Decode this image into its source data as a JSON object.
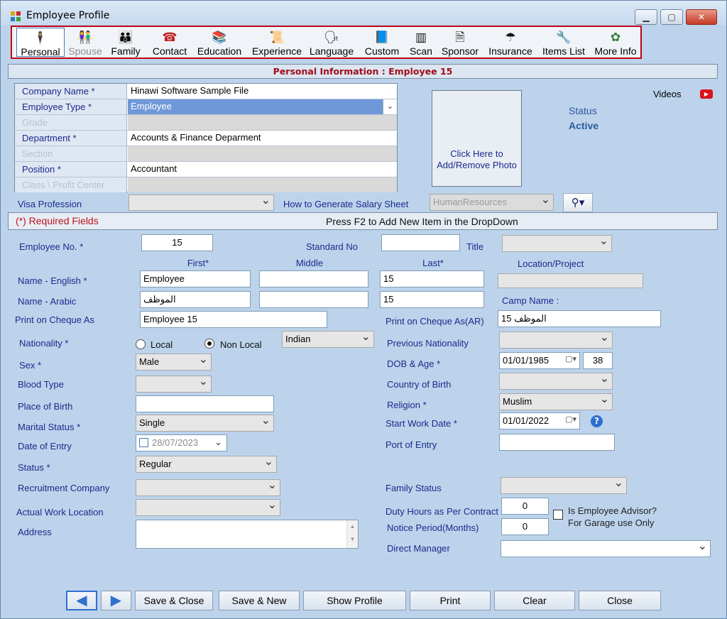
{
  "window": {
    "title": "Employee Profile",
    "minimize": "▁",
    "maximize": "▢",
    "close": "✕"
  },
  "toolbar": [
    {
      "label": "Personal",
      "icon": "person-icon",
      "glyph": "🕴",
      "selected": true
    },
    {
      "label": "Spouse",
      "icon": "couple-icon",
      "glyph": "👫",
      "disabled": true
    },
    {
      "label": "Family",
      "icon": "family-icon",
      "glyph": "👪"
    },
    {
      "label": "Contact",
      "icon": "telephone-icon",
      "glyph": "☎"
    },
    {
      "label": "Education",
      "icon": "books-icon",
      "glyph": "📚"
    },
    {
      "label": "Experience",
      "icon": "certificate-icon",
      "glyph": "📜"
    },
    {
      "label": "Language",
      "icon": "language-icon",
      "glyph": "🗣"
    },
    {
      "label": "Custom",
      "icon": "custom-icon",
      "glyph": "📘"
    },
    {
      "label": "Scan",
      "icon": "barcode-icon",
      "glyph": "▥"
    },
    {
      "label": "Sponsor",
      "icon": "document-icon",
      "glyph": "🗎"
    },
    {
      "label": "Insurance",
      "icon": "umbrella-icon",
      "glyph": "☂"
    },
    {
      "label": "Items List",
      "icon": "wrench-icon",
      "glyph": "🔧"
    },
    {
      "label": "More Info",
      "icon": "more-info-icon",
      "glyph": "✿"
    }
  ],
  "banner": "Personal Information : Employee 15",
  "grid": {
    "company_name": {
      "label": "Company Name  *",
      "value": "Hinawi Software Sample File"
    },
    "employee_type": {
      "label": "Employee Type  *",
      "value": "Employee"
    },
    "grade": {
      "label": "Grade",
      "value": ""
    },
    "department": {
      "label": "Department  *",
      "value": "Accounts & Finance Deparment"
    },
    "section": {
      "label": "Section",
      "value": ""
    },
    "position": {
      "label": "Position  *",
      "value": "Accountant"
    },
    "class": {
      "label": "Class \\ Profit Center",
      "value": ""
    }
  },
  "photo": {
    "text": "Click Here to Add/Remove Photo"
  },
  "videos": "Videos",
  "status": {
    "label": "Status",
    "value": "Active"
  },
  "visa_profession": {
    "label": "Visa Profession",
    "value": ""
  },
  "salary_sheet": {
    "label": "How to Generate Salary Sheet",
    "value": "HumanResources"
  },
  "required_fields": "(*) Required Fields",
  "f2_hint": "Press F2 to Add New Item in the DropDown",
  "form": {
    "employee_no": {
      "label": "Employee No.  *",
      "value": "15"
    },
    "standard_no": {
      "label": "Standard No",
      "value": ""
    },
    "title": {
      "label": "Title",
      "value": ""
    },
    "col_first": "First*",
    "col_middle": "Middle",
    "col_last": "Last*",
    "location_project": {
      "label": "Location/Project",
      "value": ""
    },
    "name_english": {
      "label": "Name - English  *",
      "first": "Employee",
      "middle": "",
      "last": "15"
    },
    "name_arabic": {
      "label": "Name - Arabic",
      "first": "الموظف",
      "middle": "",
      "last": "15"
    },
    "camp_name": {
      "label": "Camp Name :"
    },
    "print_cheque": {
      "label": "Print on Cheque As",
      "value": "Employee 15"
    },
    "print_cheque_ar": {
      "label": "Print on Cheque As(AR)",
      "value": "الموظف 15"
    },
    "nationality": {
      "label": "Nationality  *",
      "local": "Local",
      "non_local": "Non Local",
      "value": "Indian"
    },
    "previous_nationality": {
      "label": "Previous Nationality",
      "value": ""
    },
    "sex": {
      "label": "Sex  *",
      "value": "Male"
    },
    "dob": {
      "label": "DOB & Age  *",
      "value": "01/01/1985",
      "age": "38"
    },
    "blood_type": {
      "label": "Blood Type",
      "value": ""
    },
    "country_of_birth": {
      "label": "Country of Birth",
      "value": ""
    },
    "place_of_birth": {
      "label": "Place of Birth",
      "value": ""
    },
    "religion": {
      "label": "Religion  *",
      "value": "Muslim"
    },
    "marital_status": {
      "label": "Marital Status  *",
      "value": "Single"
    },
    "start_work_date": {
      "label": "Start Work Date  *",
      "value": "01/01/2022"
    },
    "date_of_entry": {
      "label": "Date of Entry",
      "value": "28/07/2023"
    },
    "port_of_entry": {
      "label": "Port of Entry",
      "value": ""
    },
    "status": {
      "label": "Status  *",
      "value": "Regular"
    },
    "recruitment_company": {
      "label": "Recruitment Company",
      "value": ""
    },
    "family_status": {
      "label": "Family Status",
      "value": ""
    },
    "actual_work_location": {
      "label": "Actual Work Location",
      "value": ""
    },
    "duty_hours": {
      "label": "Duty Hours as Per Contract",
      "value": "0"
    },
    "notice_period": {
      "label": "Notice Period(Months)",
      "value": "0"
    },
    "advisor": {
      "label": "Is Employee Advisor?\nFor Garage use Only"
    },
    "address": {
      "label": "Address",
      "value": ""
    },
    "direct_manager": {
      "label": "Direct Manager",
      "value": ""
    }
  },
  "buttons": {
    "prev": "◀",
    "next": "▶",
    "save_close": "Save & Close",
    "save_new": "Save & New",
    "show_profile": "Show Profile",
    "print": "Print",
    "clear": "Clear",
    "close": "Close"
  }
}
